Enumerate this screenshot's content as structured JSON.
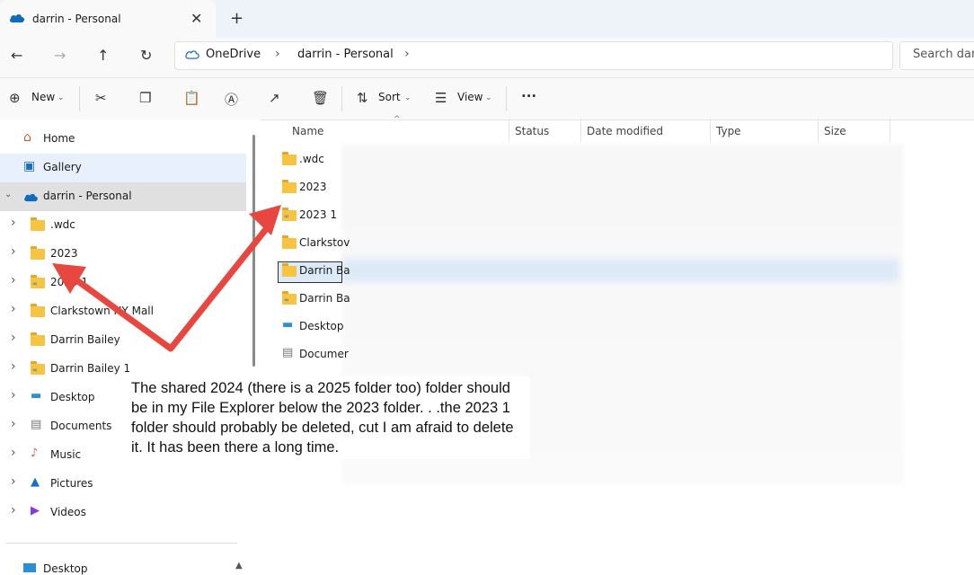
{
  "tab": {
    "title": "darrin - Personal",
    "close": "✕",
    "new": "+"
  },
  "address": {
    "segments": [
      "OneDrive",
      "darrin - Personal"
    ],
    "search_placeholder": "Search darr"
  },
  "toolbar": {
    "new_label": "New",
    "sort_label": "Sort",
    "view_label": "View",
    "more": "···"
  },
  "sidebar": {
    "home": "Home",
    "gallery": "Gallery",
    "personal": "darrin - Personal",
    "items": [
      {
        "label": ".wdc",
        "kind": "folder"
      },
      {
        "label": "2023",
        "kind": "folder"
      },
      {
        "label": "2023 1",
        "kind": "shared-folder"
      },
      {
        "label": "Clarkstown NY Mall",
        "kind": "folder"
      },
      {
        "label": "Darrin Bailey",
        "kind": "folder"
      },
      {
        "label": "Darrin Bailey 1",
        "kind": "shared-folder"
      },
      {
        "label": "Desktop",
        "kind": "desktop"
      },
      {
        "label": "Documents",
        "kind": "documents"
      },
      {
        "label": "Music",
        "kind": "music"
      },
      {
        "label": "Pictures",
        "kind": "pictures"
      },
      {
        "label": "Videos",
        "kind": "videos"
      }
    ],
    "bottom": "Desktop"
  },
  "columns": {
    "name": "Name",
    "status": "Status",
    "date": "Date modified",
    "type": "Type",
    "size": "Size"
  },
  "files": [
    {
      "name": ".wdc",
      "kind": "folder"
    },
    {
      "name": "2023",
      "kind": "folder"
    },
    {
      "name": "2023 1",
      "kind": "shared-folder"
    },
    {
      "name": "Clarkstov",
      "kind": "folder"
    },
    {
      "name": "Darrin Ba",
      "kind": "folder"
    },
    {
      "name": "Darrin Ba",
      "kind": "shared-folder"
    },
    {
      "name": "Desktop",
      "kind": "desktop"
    },
    {
      "name": "Documer",
      "kind": "documents"
    }
  ],
  "annotation": "The shared 2024 (there is a 2025 folder too) folder should be in my File Explorer below the 2023 folder. . .the 2023 1 folder should probably be deleted, cut I am afraid to delete it.  It has been there a long time.",
  "colors": {
    "arrow": "#e8473f",
    "folder": "#f6c442",
    "selection": "#cce4f7",
    "gallery_bg": "#e8f1fb",
    "personal_bg": "#e0e0e0"
  }
}
